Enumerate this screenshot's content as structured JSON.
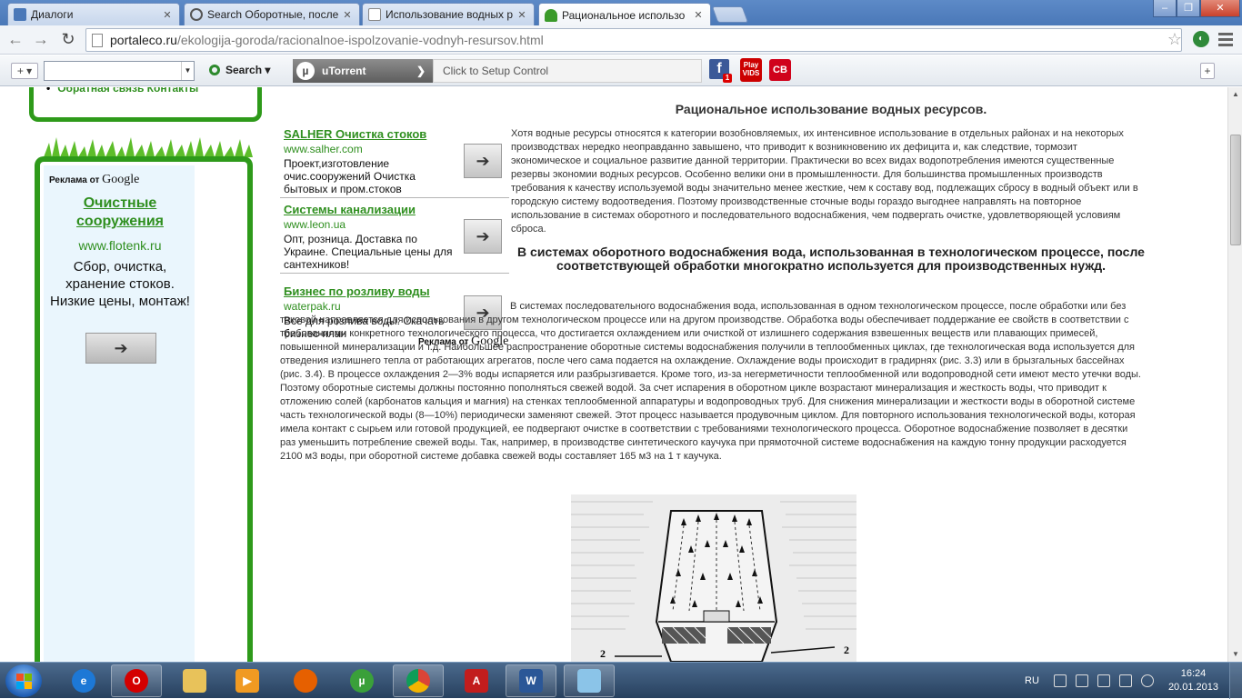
{
  "browser": {
    "tabs": [
      {
        "title": "Диалоги",
        "active": false
      },
      {
        "title": "Search Оборотные, после",
        "active": false
      },
      {
        "title": "Использование водных р",
        "active": false
      },
      {
        "title": "Рациональное использо",
        "active": true
      }
    ],
    "url_domain": "portaleco.ru",
    "url_path": "/ekologija-goroda/racionalnoe-ispolzovanie-vodnyh-resursov.html"
  },
  "toolbar": {
    "search_label": "Search",
    "utorrent_label": "uTorrent",
    "setup_label": "Click to Setup Control",
    "play_label": "Play VIDS",
    "cb_label": "CB",
    "fb_label": "f",
    "fb_badge": "1"
  },
  "sidebar": {
    "nav_item": "Обратная связь Контакты",
    "ad_by": "Реклама от",
    "google": "Google",
    "ad_title": "Очистные сооружения",
    "ad_url": "www.flotenk.ru",
    "ad_text": "Сбор, очистка, хранение стоков. Низкие цены, монтаж!"
  },
  "middle_ads": [
    {
      "title": "SALHER Очистка стоков",
      "url": "www.salher.com",
      "desc": "Проект,изготовление очис.сооружений Очистка бытовых и пром.стоков"
    },
    {
      "title": "Системы канализации",
      "url": "www.leon.ua",
      "desc": "Опт, розница. Доставка по Украине. Специальные цены для сантехников!"
    },
    {
      "title": "Бизнес по розливу воды",
      "url": "waterpak.ru",
      "desc": "Все для розлива воды. Скачать бизнес-план"
    }
  ],
  "article": {
    "title": "Рациональное использование водных ресурсов.",
    "para1": "Хотя водные ресурсы относятся к категории возобновляемых, их интенсивное использование в отдельных районах и на некоторых производствах нередко неоправданно завышено, что приводит к возникновению их дефицита и, как следствие, тормозит экономическое и социальное развитие данной территории. Практически во всех видах водопотребления имеются существенные резервы экономии водных ресурсов. Особенно велики они в промышленности. Для большинства промышленных производств требования к качеству используемой воды значительно менее жесткие, чем к составу вод, подлежащих сбросу в водный объект или в городскую систему водоотведения. Поэтому производственные сточные воды гораздо выгоднее направлять на повторное использование в системах оборотного и последовательного водоснабжения, чем подвергать очистке, удовлетворяющей условиям сброса.",
    "heading2": "В системах оборотного водоснабжения вода, использованная в технологическом процессе, после соответствующей обработки многократно используется для производственных нужд.",
    "para2": " В системах последовательного водоснабжения вода, использованная в одном технологическом процессе, после обработки или без таковой направляется для использования в другом технологическом процессе или на другом производстве. Обработка воды обеспечивает поддержание ее свойств в соответствии с требованиями конкретного технологического процесса, что достигается охлаждением или очисткой от излишнего содержания взвешенных веществ или плавающих примесей, повышенной минерализации и т.д. Наибольшее распространение оборотные системы водоснабжения получили в теплообменных циклах, где технологическая вода используется для отведения излишнего тепла от работающих агрегатов, после чего сама подается на охлаждение. Охлаждение воды происходит в градирнях (рис. 3.3) или в брызгальных бассейнах (рис. 3.4). В процессе охлаждения 2—3% воды испаряется или разбрызгивается. Кроме того, из-за негерметичности теплообменной или водопроводной сети имеют место утечки воды. Поэтому оборотные системы должны постоянно пополняться свежей водой. За счет испарения в оборотном цикле возрастают минерализация и жесткость воды, что приводит к отложению солей (карбонатов кальция и магния) на стенках теплообменной аппаратуры и водопроводных труб. Для снижения минерализации и жесткости воды в оборотной системе часть технологической воды (8—10%) периодически заменяют свежей. Этот процесс называется продувочным циклом. Для повторного использования технологической воды, которая имела контакт с сырьем или готовой продукцией, ее подвергают очистке в соответствии с требованиями технологического процесса. Оборотное водоснабжение позволяет в десятки раз уменьшить потребление свежей воды. Так, например, в производстве синтетического каучука при прямоточной системе водоснабжения на каждую тонну продукции расходуется 2100 м3 воды, при оборотной системе добавка свежей воды составляет 165 м3 на 1 т каучука.",
    "figure_label_left": "2",
    "figure_label_right": "2"
  },
  "taskbar": {
    "lang": "RU",
    "time": "16:24",
    "date": "20.01.2013"
  },
  "colors": {
    "link_green": "#2f8f1f",
    "frame_green": "#2e9a1a",
    "taskbar": "#2f4a6b"
  }
}
